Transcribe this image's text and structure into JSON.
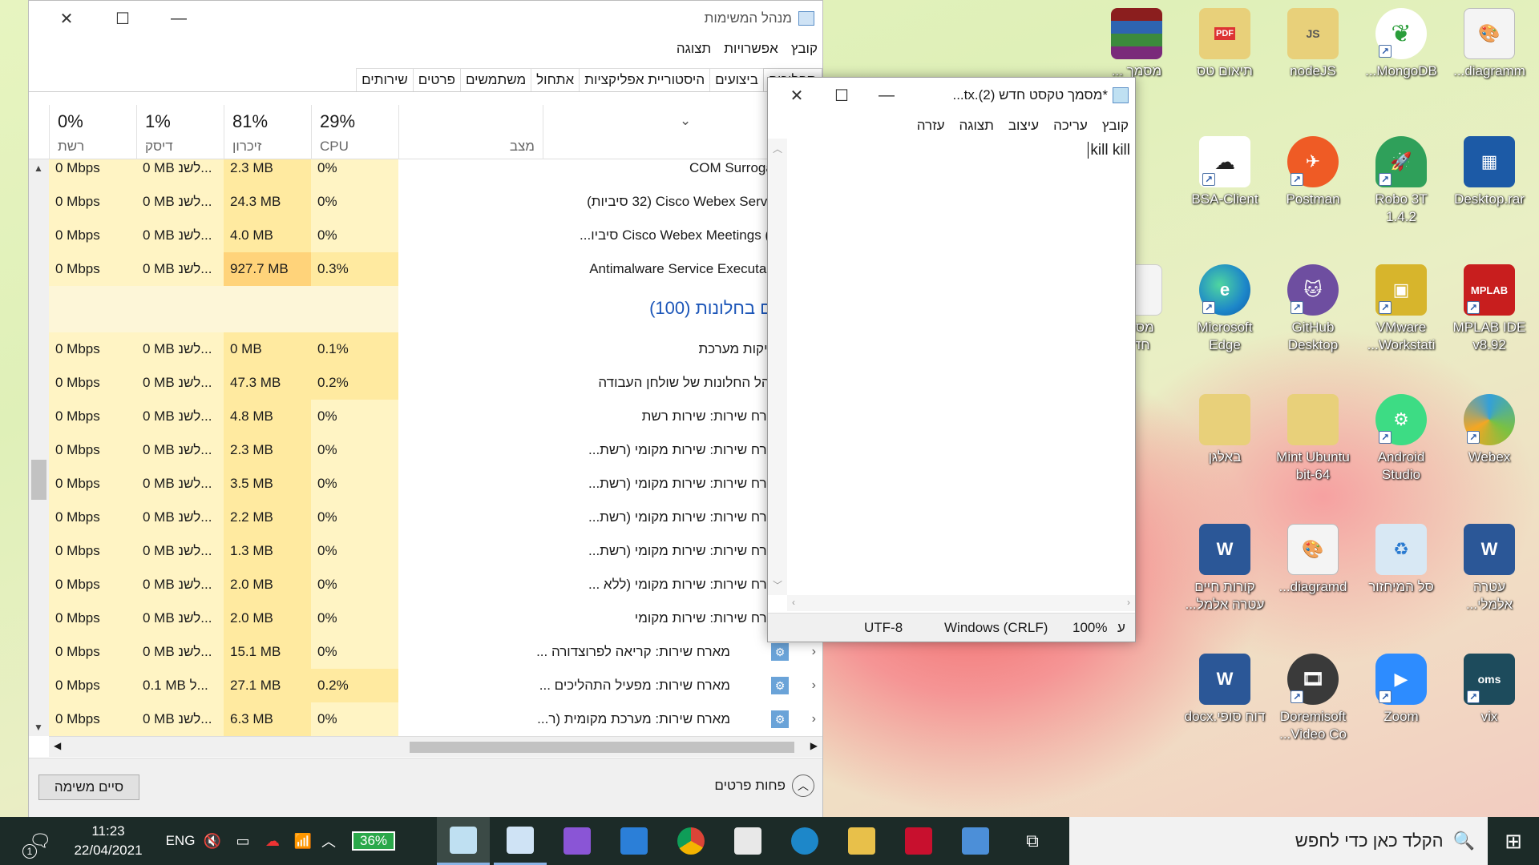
{
  "taskmgr": {
    "title": "מנהל המשימות",
    "menu": [
      "קובץ",
      "אפשרויות",
      "תצוגה"
    ],
    "tabs": [
      "תהליכים",
      "ביצועים",
      "היסטוריית אפליקציות",
      "אתחול",
      "משתמשים",
      "פרטים",
      "שירותים"
    ],
    "columns": {
      "status": "מצב",
      "cpu": {
        "pct": "29%",
        "name": "CPU"
      },
      "mem": {
        "pct": "81%",
        "name": "זיכרון"
      },
      "disk": {
        "pct": "1%",
        "name": "דיסק"
      },
      "net": {
        "pct": "0%",
        "name": "רשת"
      }
    },
    "group_header": "תהליכים בחלונות (100)",
    "rows_top": [
      {
        "name": "COM Surrogate",
        "cpu": "0%",
        "mem": "2.3 MB",
        "disk": "0 MB לשנ...",
        "net": "0 Mbps"
      },
      {
        "name": "Cisco Webex Service (32 סיביות)",
        "cpu": "0%",
        "mem": "24.3 MB",
        "disk": "0 MB לשנ...",
        "net": "0 Mbps"
      },
      {
        "name": "Cisco Webex Meetings (32 סיביו...",
        "cpu": "0%",
        "mem": "4.0 MB",
        "disk": "0 MB לשנ...",
        "net": "0 Mbps"
      },
      {
        "name": "Antimalware Service Executable",
        "cpu": "0.3%",
        "mem": "927.7 MB",
        "disk": "0 MB לשנ...",
        "net": "0 Mbps"
      }
    ],
    "rows_bottom": [
      {
        "name": "פסיקות מערכת",
        "cpu": "0.1%",
        "mem": "0 MB",
        "disk": "0 MB לשנ...",
        "net": "0 Mbps"
      },
      {
        "name": "מנהל החלונות של שולחן העבודה",
        "cpu": "0.2%",
        "mem": "47.3 MB",
        "disk": "0 MB לשנ...",
        "net": "0 Mbps"
      },
      {
        "name": "מארח שירות: שירות רשת",
        "cpu": "0%",
        "mem": "4.8 MB",
        "disk": "0 MB לשנ...",
        "net": "0 Mbps"
      },
      {
        "name": "מארח שירות: שירות מקומי (רשת...",
        "cpu": "0%",
        "mem": "2.3 MB",
        "disk": "0 MB לשנ...",
        "net": "0 Mbps"
      },
      {
        "name": "מארח שירות: שירות מקומי (רשת...",
        "cpu": "0%",
        "mem": "3.5 MB",
        "disk": "0 MB לשנ...",
        "net": "0 Mbps"
      },
      {
        "name": "מארח שירות: שירות מקומי (רשת...",
        "cpu": "0%",
        "mem": "2.2 MB",
        "disk": "0 MB לשנ...",
        "net": "0 Mbps"
      },
      {
        "name": "מארח שירות: שירות מקומי (רשת...",
        "cpu": "0%",
        "mem": "1.3 MB",
        "disk": "0 MB לשנ...",
        "net": "0 Mbps"
      },
      {
        "name": "מארח שירות: שירות מקומי (ללא ...",
        "cpu": "0%",
        "mem": "2.0 MB",
        "disk": "0 MB לשנ...",
        "net": "0 Mbps"
      },
      {
        "name": "מארח שירות: שירות מקומי",
        "cpu": "0%",
        "mem": "2.0 MB",
        "disk": "0 MB לשנ...",
        "net": "0 Mbps"
      },
      {
        "name": "מארח שירות: קריאה לפרוצדורה ...",
        "cpu": "0%",
        "mem": "15.1 MB",
        "disk": "0 MB לשנ...",
        "net": "0 Mbps"
      },
      {
        "name": "מארח שירות: מפעיל התהליכים ...",
        "cpu": "0.2%",
        "mem": "27.1 MB",
        "disk": "0.1 MB ל...",
        "net": "0 Mbps"
      },
      {
        "name": "מארח שירות: מערכת מקומית (ר...",
        "cpu": "0%",
        "mem": "6.3 MB",
        "disk": "0 MB לשנ...",
        "net": "0 Mbps"
      }
    ],
    "end_task": "סיים משימה",
    "fewer_details": "פחות פרטים"
  },
  "notepad": {
    "title": "*מסמך טקסט חדש (2).tx...",
    "menu": [
      "קובץ",
      "עריכה",
      "עיצוב",
      "תצוגה",
      "עזרה"
    ],
    "content": "kill kill",
    "status": {
      "encoding": "UTF-8",
      "eol": "Windows (CRLF)",
      "zoom": "100%",
      "pos": "ע"
    }
  },
  "desktop_icons": [
    {
      "label": "מסמך ...",
      "color": "#8b1e1e"
    },
    {
      "label": "תיאום טס",
      "color": "#e8d07a"
    },
    {
      "label": "nodeJS",
      "color": "#e8d07a"
    },
    {
      "label": "MongoDB...",
      "color": "#ffffff"
    },
    {
      "label": "diagramm...",
      "color": "#f4f4f4"
    },
    {
      "label": "BSA-Client",
      "color": "#ffffff"
    },
    {
      "label": "Postman",
      "color": "#ef5b25"
    },
    {
      "label": "Robo 3T\n1.4.2",
      "color": "#2fa05a"
    },
    {
      "label": "Desktop.rar",
      "color": "#1c5aa6"
    },
    {
      "label": "Microsoft\nEdge",
      "color": "#1d87c9"
    },
    {
      "label": "GitHub\nDesktop",
      "color": "#6e4ea0"
    },
    {
      "label": "VMware\nWorkstati...",
      "color": "#d7b52c"
    },
    {
      "label": "MPLAB IDE\nv8.92",
      "color": "#c81e1e"
    },
    {
      "label": "באלגן",
      "color": "#e8d07a"
    },
    {
      "label": "Mint Ubuntu\n64-bit",
      "color": "#e8d07a"
    },
    {
      "label": "Android\nStudio",
      "color": "#3ddc84"
    },
    {
      "label": "Webex",
      "color": "#34a0d8"
    },
    {
      "label": "עטרה\nאלמלי...",
      "color": "#2b5797"
    },
    {
      "label": "סל המיחזור",
      "color": "#d8e8f4"
    },
    {
      "label": "diagramd...",
      "color": "#f4f4f4"
    },
    {
      "label": "קורות חיים\nעטרה אלמל...",
      "color": "#2b5797"
    },
    {
      "label": "vix",
      "color": "#1d4b5c"
    },
    {
      "label": "Zoom",
      "color": "#2d8cff"
    },
    {
      "label": "Doremisoft\nVideo Co...",
      "color": "#3a3a3a"
    },
    {
      "label": "דוח סופי.docx",
      "color": "#2b5797"
    },
    {
      "label": "מסמך\nחדש",
      "color": "#f4f4f4"
    }
  ],
  "taskbar": {
    "search_placeholder": "הקלד כאן כדי לחפש",
    "time": "11:23",
    "date": "22/04/2021",
    "lang": "ENG",
    "battery": "36%",
    "notif_count": "1"
  }
}
